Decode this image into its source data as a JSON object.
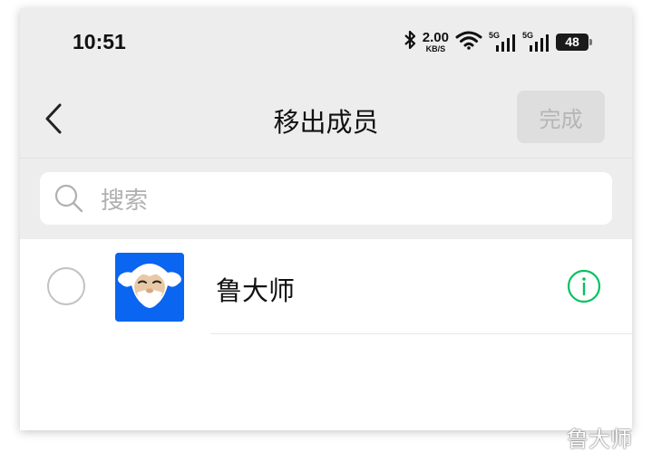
{
  "status_bar": {
    "time": "10:51",
    "speed_value": "2.00",
    "speed_unit": "KB/S",
    "signal_1_label": "5G",
    "signal_2_label": "5G",
    "battery": "48",
    "icons": [
      "bluetooth-icon",
      "wifi-icon",
      "signal-icon",
      "battery-icon"
    ]
  },
  "header": {
    "title": "移出成员",
    "done_label": "完成",
    "back_icon": "chevron-left-icon"
  },
  "search": {
    "placeholder": "搜索",
    "icon": "search-icon"
  },
  "members": [
    {
      "name": "鲁大师",
      "selected": false,
      "avatar": "ludashi-logo"
    }
  ],
  "watermark": "鲁大师",
  "colors": {
    "background": "#ededed",
    "accent": "#07c160",
    "avatar_bg": "#0a65f0",
    "done_bg": "#dedede",
    "done_text": "#b5b5b5"
  }
}
